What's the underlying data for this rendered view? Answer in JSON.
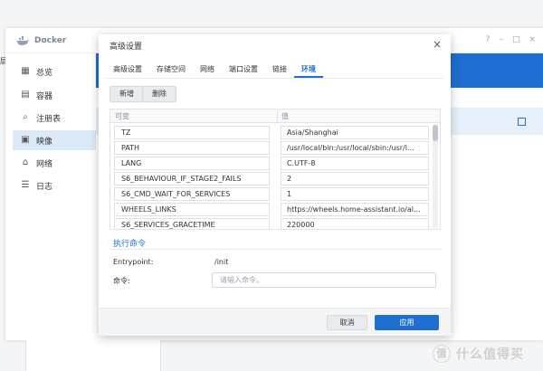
{
  "docker": {
    "title": "Docker",
    "window_controls": [
      "?",
      "–",
      "□",
      "×"
    ],
    "sidebar": [
      {
        "label": "总览",
        "icon": "dashboard-icon"
      },
      {
        "label": "容器",
        "icon": "container-icon"
      },
      {
        "label": "注册表",
        "icon": "registry-icon"
      },
      {
        "label": "映像",
        "icon": "image-icon",
        "active": true
      },
      {
        "label": "网络",
        "icon": "network-icon"
      },
      {
        "label": "日志",
        "icon": "log-icon"
      }
    ]
  },
  "modal": {
    "title": "高级设置",
    "tabs": [
      "高级设置",
      "存储空间",
      "网络",
      "端口设置",
      "链接",
      "环境"
    ],
    "active_tab": "环境",
    "add_label": "新增",
    "delete_label": "删除",
    "columns": {
      "variable": "可变",
      "value": "值"
    },
    "env_rows": [
      {
        "key": "TZ",
        "value": "Asia/Shanghai"
      },
      {
        "key": "PATH",
        "value": "/usr/local/bin:/usr/local/sbin:/usr/l..."
      },
      {
        "key": "LANG",
        "value": "C.UTF-8"
      },
      {
        "key": "S6_BEHAVIOUR_IF_STAGE2_FAILS",
        "value": "2"
      },
      {
        "key": "S6_CMD_WAIT_FOR_SERVICES",
        "value": "1"
      },
      {
        "key": "WHEELS_LINKS",
        "value": "https://wheels.home-assistant.io/al..."
      },
      {
        "key": "S6_SERVICES_GRACETIME",
        "value": "220000"
      }
    ],
    "exec_section": "执行命令",
    "entrypoint_label": "Entrypoint:",
    "entrypoint_value": "/init",
    "command_label": "命令:",
    "command_placeholder": "请输入命令。",
    "cancel_label": "取消",
    "apply_label": "应用"
  },
  "left_edge_label": "层",
  "watermark": {
    "badge": "值",
    "text": "什么值得买"
  }
}
